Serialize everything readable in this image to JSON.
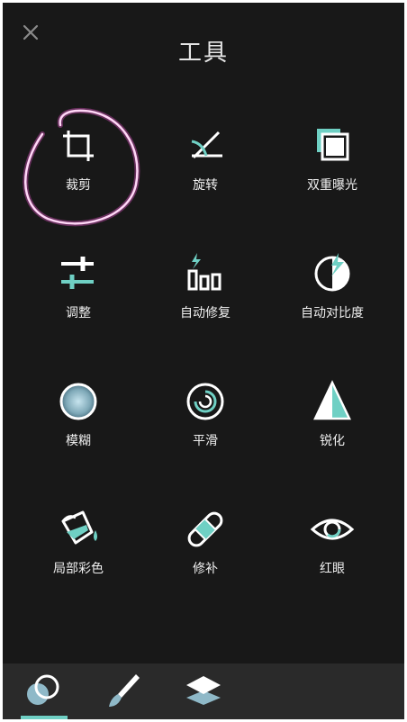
{
  "header": {
    "title": "工具",
    "close_icon": "close-icon"
  },
  "tools": [
    {
      "label": "裁剪",
      "icon": "crop-icon"
    },
    {
      "label": "旋转",
      "icon": "rotate-icon"
    },
    {
      "label": "双重曝光",
      "icon": "double-exposure-icon"
    },
    {
      "label": "调整",
      "icon": "adjust-sliders-icon"
    },
    {
      "label": "自动修复",
      "icon": "auto-fix-icon"
    },
    {
      "label": "自动对比度",
      "icon": "auto-contrast-icon"
    },
    {
      "label": "模糊",
      "icon": "blur-icon"
    },
    {
      "label": "平滑",
      "icon": "smooth-icon"
    },
    {
      "label": "锐化",
      "icon": "sharpen-icon"
    },
    {
      "label": "局部彩色",
      "icon": "color-splash-icon"
    },
    {
      "label": "修补",
      "icon": "heal-bandage-icon"
    },
    {
      "label": "红眼",
      "icon": "red-eye-icon"
    }
  ],
  "bottom_tabs": [
    {
      "icon": "tools-circles-icon",
      "selected": true
    },
    {
      "icon": "brush-icon",
      "selected": false
    },
    {
      "icon": "layers-icon",
      "selected": false
    }
  ],
  "colors": {
    "background": "#181818",
    "accent": "#6fd0c4",
    "icon": "#ffffff",
    "annotation": "#ff5ce0",
    "bottom_bar": "#2a2a2a"
  }
}
